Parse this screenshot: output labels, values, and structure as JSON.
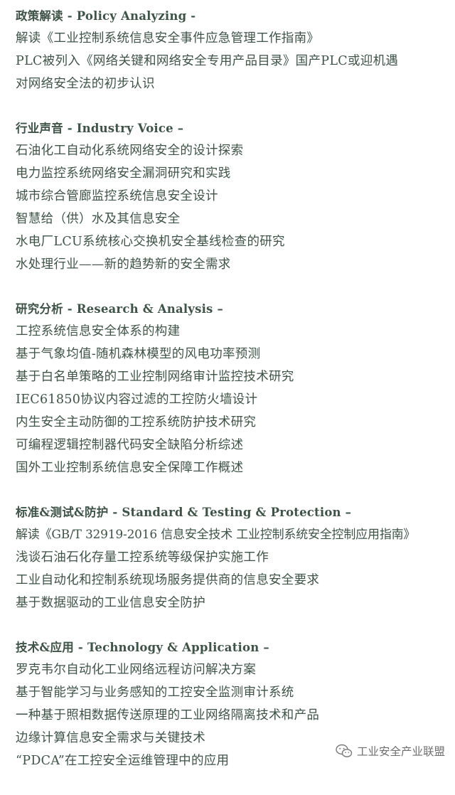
{
  "sections": [
    {
      "heading": "政策解读 - Policy Analyzing -",
      "items": [
        "解读《工业控制系统信息安全事件应急管理工作指南》",
        "PLC被列入《网络关键和网络安全专用产品目录》国产PLC或迎机遇",
        "对网络安全法的初步认识"
      ]
    },
    {
      "heading": "行业声音 - Industry Voice –",
      "items": [
        "石油化工自动化系统网络安全的设计探索",
        "电力监控系统网络安全漏洞研究和实践",
        "城市综合管廊监控系统信息安全设计",
        "智慧给（供）水及其信息安全",
        "水电厂LCU系统核心交换机安全基线检查的研究",
        "水处理行业——新的趋势新的安全需求"
      ]
    },
    {
      "heading": "研究分析 - Research & Analysis –",
      "items": [
        "工控系统信息安全体系的构建",
        "基于气象均值-随机森林模型的风电功率预测",
        "基于白名单策略的工业控制网络审计监控技术研究",
        "IEC61850协议内容过滤的工控防火墙设计",
        "内生安全主动防御的工控系统防护技术研究",
        "可编程逻辑控制器代码安全缺陷分析综述",
        "国外工业控制系统信息安全保障工作概述"
      ]
    },
    {
      "heading": "标准&测试&防护 - Standard & Testing & Protection –",
      "items": [
        "解读《GB/T 32919-2016 信息安全技术 工业控制系统安全控制应用指南》",
        "浅谈石油石化存量工控系统等级保护实施工作",
        "工业自动化和控制系统现场服务提供商的信息安全要求",
        "基于数据驱动的工业信息安全防护"
      ]
    },
    {
      "heading": "技术&应用 - Technology & Application –",
      "items": [
        "罗克韦尔自动化工业网络远程访问解决方案",
        "基于智能学习与业务感知的工控安全监测审计系统",
        "一种基于照相数据传送原理的工业网络隔离技术和产品",
        "边缘计算信息安全需求与关键技术",
        "“PDCA”在工控安全运维管理中的应用"
      ]
    }
  ],
  "watermark": {
    "text": "工业安全产业联盟",
    "icon": "wechat-icon"
  },
  "colors": {
    "text": "#3f5349",
    "watermark": "#6f6f6f"
  }
}
